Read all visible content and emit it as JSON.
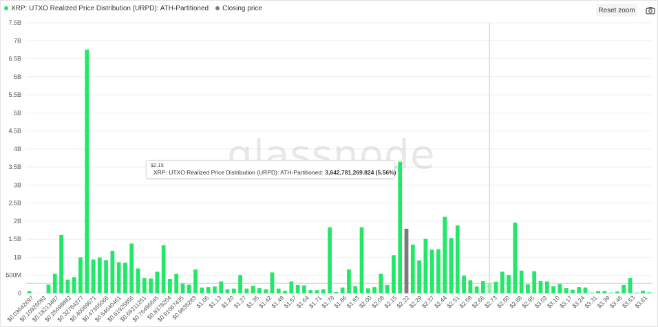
{
  "legend": {
    "items": [
      {
        "label": "XRP: UTXO Realized Price Distribution (URPD): ATH-Partitioned",
        "color": "#22e868"
      },
      {
        "label": "Closing price",
        "color": "#7a7a7a"
      }
    ]
  },
  "toolbar": {
    "reset_zoom_label": "Reset zoom",
    "camera_icon": "camera-icon"
  },
  "watermark": "glassnode",
  "tooltip": {
    "date": "$2.15",
    "series_label": "XRP: UTXO Realized Price Distribution (URPD): ATH-Partitioned:",
    "value_text": "3,642,781,269.824 (5.56%)",
    "dot_color": "#22e868"
  },
  "colors": {
    "bar": "#22e868",
    "bar_highlight": "#8ef0a8",
    "closing_price": "#7a7a7a",
    "grid": "#eeeeee",
    "crosshair": "#cccccc"
  },
  "chart_data": {
    "type": "bar",
    "title": "",
    "xlabel": "",
    "ylabel": "",
    "ylim": [
      0,
      7500000000
    ],
    "y_ticks": [
      0,
      500000000,
      1000000000,
      1500000000,
      2000000000,
      2500000000,
      3000000000,
      3500000000,
      4000000000,
      4500000000,
      5000000000,
      5500000000,
      6000000000,
      6500000000,
      7000000000,
      7500000000
    ],
    "y_tick_labels": [
      "0",
      "500M",
      "1B",
      "1.5B",
      "2B",
      "2.5B",
      "3B",
      "3.5B",
      "4B",
      "4.5B",
      "5B",
      "5.5B",
      "6B",
      "6.5B",
      "7B",
      "7.5B"
    ],
    "grid": true,
    "legend_position": "top-left",
    "x_tick_labels": [
      "$0.03642697",
      "$0.10926092",
      "$0.18213487",
      "$0.25498882",
      "$0.32784277",
      "$0.40069671",
      "$0.47355066",
      "$0.54640461",
      "$0.61925856",
      "$0.69211251",
      "$0.76496645",
      "$0.8378204",
      "$0.91067435",
      "$0.9835283",
      "$1.06",
      "$1.13",
      "$1.20",
      "$1.27",
      "$1.35",
      "$1.42",
      "$1.49",
      "$1.57",
      "$1.64",
      "$1.71",
      "$1.78",
      "$1.86",
      "$1.93",
      "$2.00",
      "$2.08",
      "$2.15",
      "$2.22",
      "$2.29",
      "$2.37",
      "$2.44",
      "$2.51",
      "$2.59",
      "$2.66",
      "$2.73",
      "$2.80",
      "$2.88",
      "$2.95",
      "$3.02",
      "$3.10",
      "$3.17",
      "$3.24",
      "$3.31",
      "$3.39",
      "$3.46",
      "$3.53",
      "$3.61"
    ],
    "highlight_index": 72,
    "closing_price_index": 73,
    "series": [
      {
        "name": "XRP: UTXO Realized Price Distribution (URPD): ATH-Partitioned",
        "values": [
          60000000,
          0,
          0,
          240000000,
          540000000,
          1620000000,
          380000000,
          450000000,
          1000000000,
          6750000000,
          940000000,
          990000000,
          920000000,
          1180000000,
          860000000,
          850000000,
          1380000000,
          690000000,
          420000000,
          410000000,
          600000000,
          1330000000,
          400000000,
          540000000,
          270000000,
          240000000,
          660000000,
          160000000,
          170000000,
          190000000,
          330000000,
          110000000,
          130000000,
          510000000,
          130000000,
          210000000,
          150000000,
          110000000,
          580000000,
          130000000,
          70000000,
          330000000,
          230000000,
          220000000,
          90000000,
          90000000,
          110000000,
          1830000000,
          40000000,
          160000000,
          660000000,
          200000000,
          1830000000,
          140000000,
          170000000,
          540000000,
          230000000,
          1060000000,
          3642781269.824,
          0,
          1350000000,
          910000000,
          1510000000,
          1210000000,
          1220000000,
          2120000000,
          1530000000,
          1880000000,
          490000000,
          360000000,
          190000000,
          340000000,
          280000000,
          320000000,
          600000000,
          510000000,
          1960000000,
          630000000,
          250000000,
          610000000,
          340000000,
          330000000,
          200000000,
          260000000,
          150000000,
          100000000,
          170000000,
          160000000,
          20000000,
          60000000,
          60000000,
          20000000,
          50000000,
          230000000,
          420000000,
          20000000,
          70000000,
          30000000
        ]
      },
      {
        "name": "Closing price",
        "values": [
          0,
          0,
          0,
          0,
          0,
          0,
          0,
          0,
          0,
          0,
          0,
          0,
          0,
          0,
          0,
          0,
          0,
          0,
          0,
          0,
          0,
          0,
          0,
          0,
          0,
          0,
          0,
          0,
          0,
          0,
          0,
          0,
          0,
          0,
          0,
          0,
          0,
          0,
          0,
          0,
          0,
          0,
          0,
          0,
          0,
          0,
          0,
          0,
          0,
          0,
          0,
          0,
          0,
          0,
          0,
          0,
          0,
          0,
          0,
          1790000000,
          0,
          0,
          0,
          0,
          0,
          0,
          0,
          0,
          0,
          0,
          0,
          0,
          0,
          0,
          0,
          0,
          0,
          0,
          0,
          0,
          0,
          0,
          0,
          0,
          0,
          0,
          0,
          0,
          0,
          0,
          0,
          0,
          0,
          0,
          0,
          0,
          0,
          0
        ]
      }
    ]
  }
}
